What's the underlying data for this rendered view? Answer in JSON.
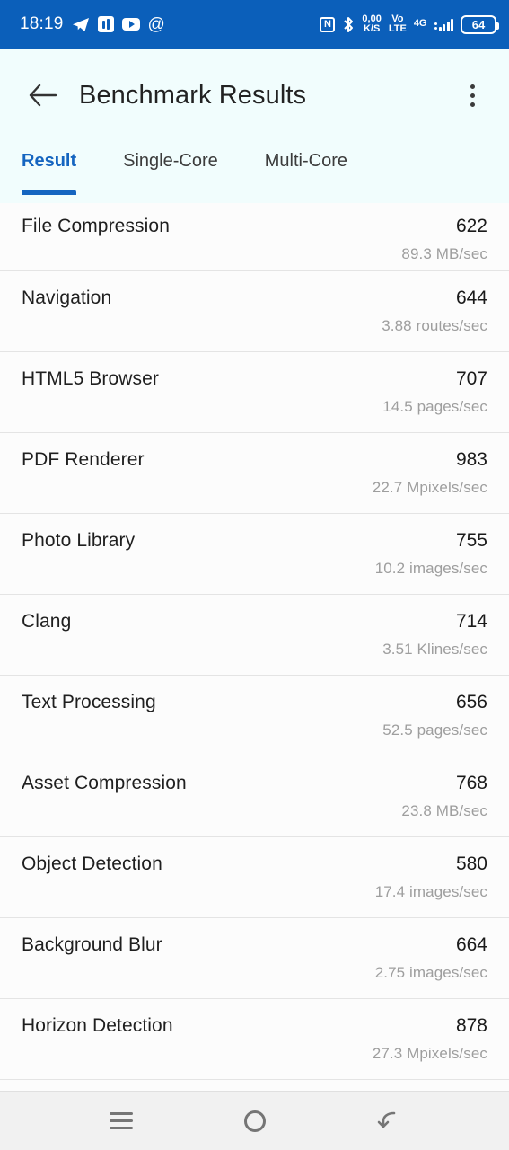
{
  "statusbar": {
    "time": "18:19",
    "left_icons": [
      "telegram-icon",
      "app-icon",
      "youtube-icon",
      "at-icon"
    ],
    "nfc_label": "N",
    "data_speed_value": "0,00",
    "data_speed_unit": "K/S",
    "volte_top": "Vo",
    "volte_bottom": "LTE",
    "network_type": "4G",
    "battery_level": "64",
    "background_color": "#0B5FBA"
  },
  "appbar": {
    "back_icon": "arrow-left-icon",
    "title": "Benchmark Results",
    "overflow_icon": "more-vertical-icon",
    "background_color": "#F1FDFD"
  },
  "tabs": {
    "active_index": 0,
    "accent_color": "#1565C0",
    "items": [
      {
        "label": "Result"
      },
      {
        "label": "Single-Core"
      },
      {
        "label": "Multi-Core"
      }
    ]
  },
  "list": {
    "rows": [
      {
        "name": "File Compression",
        "score": "622",
        "rate": "89.3 MB/sec"
      },
      {
        "name": "Navigation",
        "score": "644",
        "rate": "3.88 routes/sec"
      },
      {
        "name": "HTML5 Browser",
        "score": "707",
        "rate": "14.5 pages/sec"
      },
      {
        "name": "PDF Renderer",
        "score": "983",
        "rate": "22.7 Mpixels/sec"
      },
      {
        "name": "Photo Library",
        "score": "755",
        "rate": "10.2 images/sec"
      },
      {
        "name": "Clang",
        "score": "714",
        "rate": "3.51 Klines/sec"
      },
      {
        "name": "Text Processing",
        "score": "656",
        "rate": "52.5 pages/sec"
      },
      {
        "name": "Asset Compression",
        "score": "768",
        "rate": "23.8 MB/sec"
      },
      {
        "name": "Object Detection",
        "score": "580",
        "rate": "17.4 images/sec"
      },
      {
        "name": "Background Blur",
        "score": "664",
        "rate": "2.75 images/sec"
      },
      {
        "name": "Horizon Detection",
        "score": "878",
        "rate": "27.3 Mpixels/sec"
      }
    ]
  },
  "navbar": {
    "recents_icon": "menu-icon",
    "home_icon": "circle-icon",
    "back_icon": "back-arrow-icon",
    "background_color": "#F1F1F1"
  }
}
